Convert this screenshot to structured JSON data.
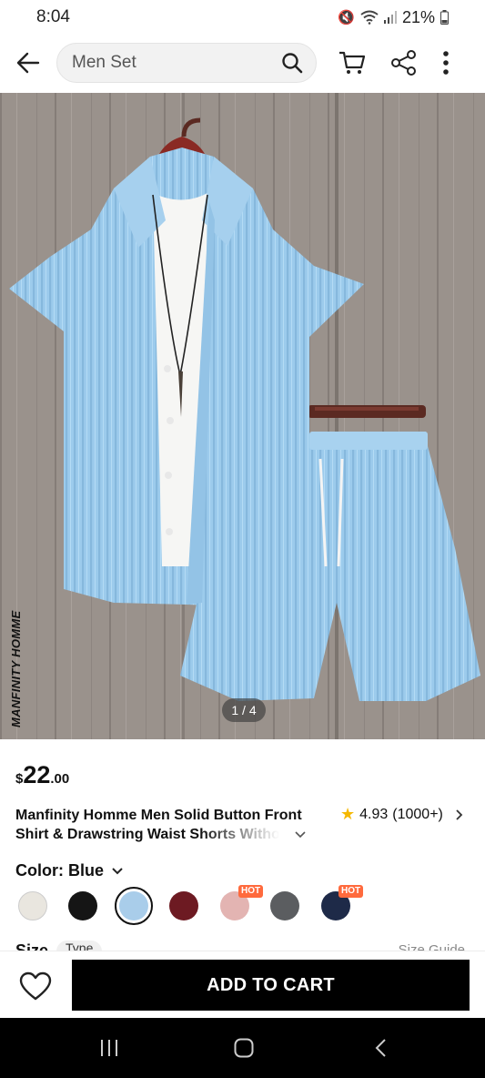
{
  "status_bar": {
    "time": "8:04",
    "battery": "21%"
  },
  "search": {
    "value": "Men Set"
  },
  "product": {
    "image_brand": "MANFINITY HOMME",
    "page_indicator": "1 / 4",
    "price": {
      "currency": "$",
      "integer": "22",
      "decimal": ".00"
    },
    "title_line1": "Manfinity Homme Men Solid Button Front",
    "title_line2": "Shirt & Drawstring Waist Shorts Without",
    "rating": {
      "score": "4.93",
      "count": "(1000+)"
    },
    "color_label": "Color: Blue",
    "swatches": [
      {
        "color": "#e9e6df",
        "hot": false
      },
      {
        "color": "#151515",
        "hot": false
      },
      {
        "color": "#a9cdea",
        "hot": false,
        "selected": true
      },
      {
        "color": "#6d1a22",
        "hot": false
      },
      {
        "color": "#e3b4b2",
        "hot": true
      },
      {
        "color": "#5b5d60",
        "hot": false
      },
      {
        "color": "#1e2a48",
        "hot": true
      }
    ],
    "hot_label": "HOT",
    "size_label": "Size",
    "size_type": "Type",
    "size_guide": "Size Guide"
  },
  "actions": {
    "add_to_cart": "ADD TO CART"
  },
  "colors": {
    "shirt": "#9ccbec",
    "accent_hot": "#ff6a3d",
    "star": "#f5b800"
  }
}
